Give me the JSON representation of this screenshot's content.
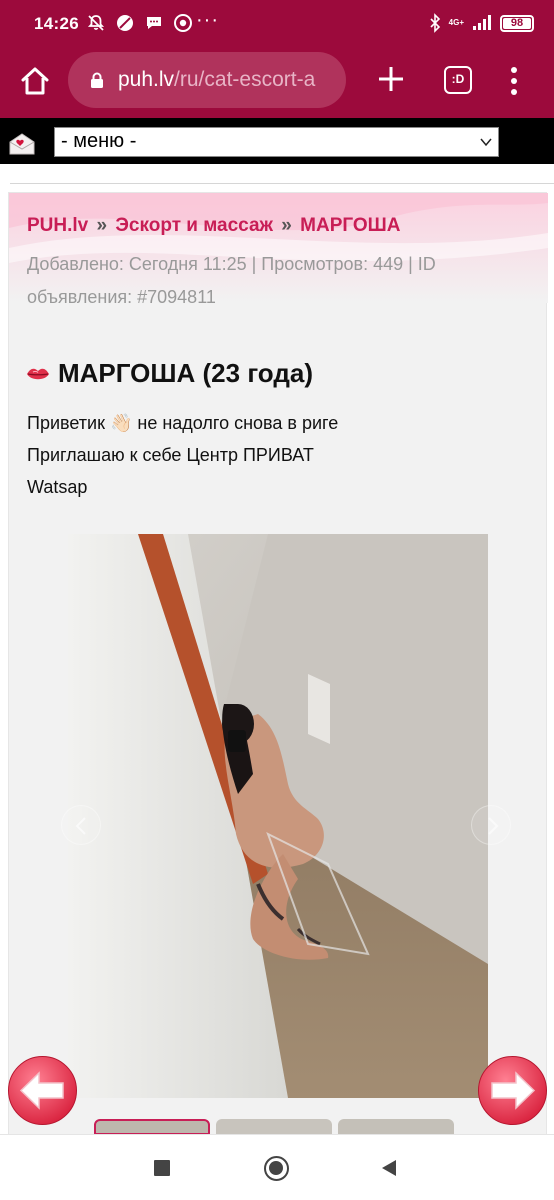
{
  "status": {
    "time": "14:26",
    "dots": "···",
    "network": "4G+",
    "battery": "98"
  },
  "browser": {
    "url_host": "puh.lv",
    "url_path": "/ru/cat-escort-a",
    "tabs_label": ":D"
  },
  "sitenav": {
    "menu_value": "- меню -"
  },
  "breadcrumb": {
    "site": "PUH.lv",
    "sep1": "»",
    "category": "Эскорт и массаж",
    "sep2": "»",
    "current": "МАРГОША"
  },
  "meta": {
    "line": "Добавлено: Сегодня 11:25 | Просмотров: 449 | ID объявления: #7094811"
  },
  "ad": {
    "title": "МАРГОША (23 года)",
    "line1_pre": "Приветик ",
    "line1_emoji": "👋🏻",
    "line1_post": " не надолго снова в риге",
    "line2": "Приглашаю к себе Центр ПРИВАТ",
    "line3": "Watsap"
  },
  "colors": {
    "brand": "#9c0a3c",
    "link": "#c81e56",
    "arrow_red": "#e0304a"
  },
  "icons": [
    "home-icon",
    "lock-icon",
    "plus-icon",
    "tabs-icon",
    "more-vert-icon",
    "envelope-icon",
    "chevron-down-icon",
    "lips-icon",
    "arrow-left-icon",
    "arrow-right-icon",
    "square-icon",
    "circle-icon",
    "back-triangle-icon"
  ]
}
